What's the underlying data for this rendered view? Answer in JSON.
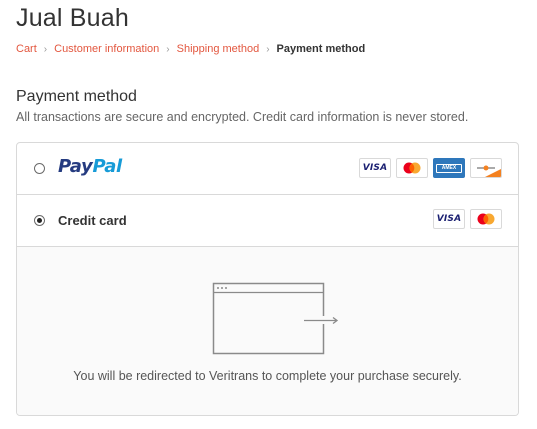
{
  "shop": {
    "title": "Jual Buah"
  },
  "breadcrumb": {
    "items": [
      "Cart",
      "Customer information",
      "Shipping method"
    ],
    "current": "Payment method"
  },
  "payment": {
    "title": "Payment method",
    "subtitle": "All transactions are secure and encrypted. Credit card information is never stored.",
    "options": [
      {
        "name": "paypal",
        "logo_part1": "Pay",
        "logo_part2": "Pal",
        "selected": false,
        "card_icons": [
          "visa-icon",
          "mastercard-icon",
          "amex-icon",
          "discover-icon"
        ]
      },
      {
        "name": "credit-card",
        "label": "Credit card",
        "selected": true,
        "card_icons": [
          "visa-icon",
          "mastercard-icon"
        ]
      }
    ],
    "card_visa_text": "VISA",
    "card_amex_text": "AMEX",
    "redirect_text": "You will be redirected to Veritrans to complete your purchase securely."
  },
  "colors": {
    "link": "#e3573f",
    "paypal_dark": "#253b80",
    "paypal_light": "#179bd7",
    "amex_blue": "#2e77bb",
    "mastercard_red": "#eb001b",
    "mastercard_orange": "#f79e1b",
    "discover_orange": "#f48120"
  }
}
